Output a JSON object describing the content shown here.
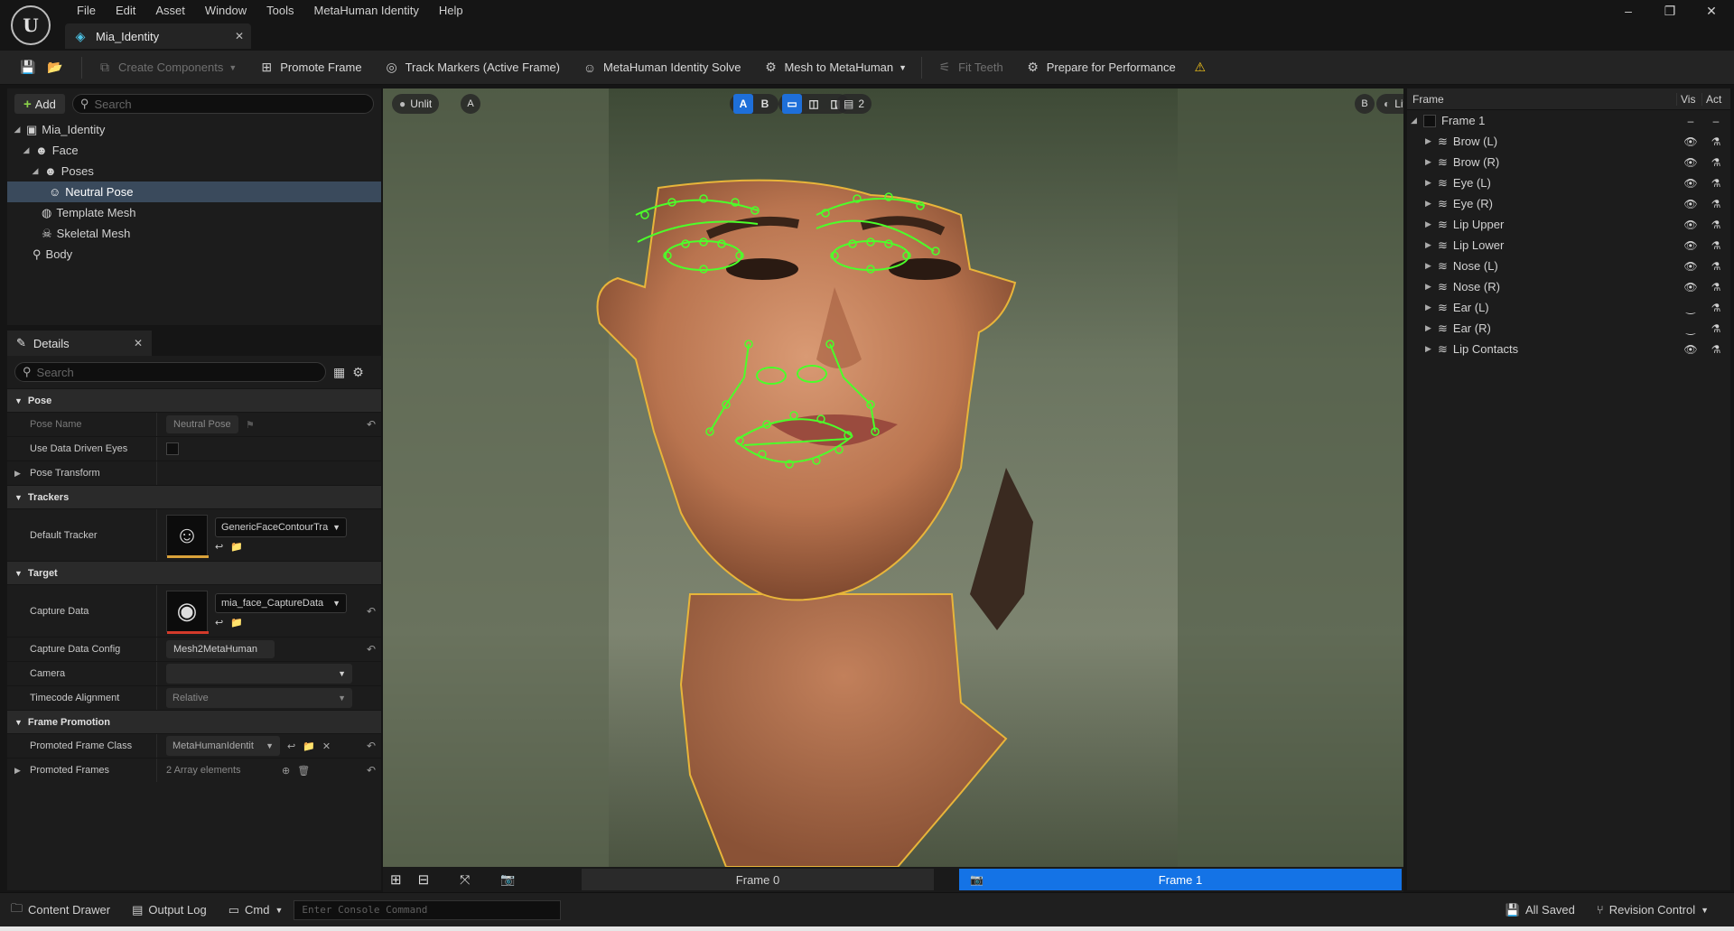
{
  "window": {
    "menu": [
      "File",
      "Edit",
      "Asset",
      "Window",
      "Tools",
      "MetaHuman Identity",
      "Help"
    ],
    "tab_title": "Mia_Identity",
    "controls": [
      "–",
      "❐",
      "✕"
    ]
  },
  "toolbar": {
    "create_components": "Create Components",
    "promote_frame": "Promote Frame",
    "track_markers": "Track Markers (Active Frame)",
    "identity_solve": "MetaHuman Identity Solve",
    "mesh_to_metahuman": "Mesh to MetaHuman",
    "fit_teeth": "Fit Teeth",
    "prepare_performance": "Prepare for Performance"
  },
  "outliner": {
    "add_label": "Add",
    "search_placeholder": "Search",
    "items": [
      {
        "label": "Mia_Identity"
      },
      {
        "label": "Face"
      },
      {
        "label": "Poses"
      },
      {
        "label": "Neutral Pose"
      },
      {
        "label": "Template Mesh"
      },
      {
        "label": "Skeletal Mesh"
      },
      {
        "label": "Body"
      }
    ]
  },
  "details": {
    "tab_label": "Details",
    "search_placeholder": "Search",
    "categories": {
      "pose": "Pose",
      "trackers": "Trackers",
      "target": "Target",
      "frame_promotion": "Frame Promotion"
    },
    "props": {
      "pose_name": {
        "label": "Pose Name",
        "value": "Neutral Pose"
      },
      "use_data_driven_eyes": {
        "label": "Use Data Driven Eyes"
      },
      "pose_transform": {
        "label": "Pose Transform"
      },
      "default_tracker": {
        "label": "Default Tracker",
        "value": "GenericFaceContourTra"
      },
      "capture_data": {
        "label": "Capture Data",
        "value": "mia_face_CaptureData"
      },
      "capture_data_config": {
        "label": "Capture Data Config",
        "value": "Mesh2MetaHuman"
      },
      "camera": {
        "label": "Camera",
        "value": ""
      },
      "timecode_alignment": {
        "label": "Timecode Alignment",
        "value": "Relative"
      },
      "promoted_frame_class": {
        "label": "Promoted Frame Class",
        "value": "MetaHumanIdentit"
      },
      "promoted_frames": {
        "label": "Promoted Frames",
        "value": "2 Array elements"
      }
    }
  },
  "viewport": {
    "unlit_label": "Unlit",
    "a_label": "A",
    "b_label": "B",
    "lit_label": "Lit",
    "cams_count": "2",
    "frame0": "Frame 0",
    "frame1": "Frame 1"
  },
  "frame_panel": {
    "col_frame": "Frame",
    "col_vis": "Vis",
    "col_act": "Act",
    "root": "Frame 1",
    "curves": [
      {
        "label": "Brow (L)",
        "vis": "on"
      },
      {
        "label": "Brow (R)",
        "vis": "on"
      },
      {
        "label": "Eye (L)",
        "vis": "on"
      },
      {
        "label": "Eye (R)",
        "vis": "on"
      },
      {
        "label": "Lip Upper",
        "vis": "on"
      },
      {
        "label": "Lip Lower",
        "vis": "on"
      },
      {
        "label": "Nose (L)",
        "vis": "on"
      },
      {
        "label": "Nose (R)",
        "vis": "on"
      },
      {
        "label": "Ear (L)",
        "vis": "off"
      },
      {
        "label": "Ear (R)",
        "vis": "off"
      },
      {
        "label": "Lip Contacts",
        "vis": "on"
      }
    ]
  },
  "statusbar": {
    "content_drawer": "Content Drawer",
    "output_log": "Output Log",
    "cmd": "Cmd",
    "console_placeholder": "Enter Console Command",
    "all_saved": "All Saved",
    "revision_control": "Revision Control"
  },
  "colors": {
    "accent_blue": "#1473e6",
    "tracker_green": "#4cff2a",
    "face_outline": "#e8b53a",
    "selection": "#3a4a5c"
  }
}
